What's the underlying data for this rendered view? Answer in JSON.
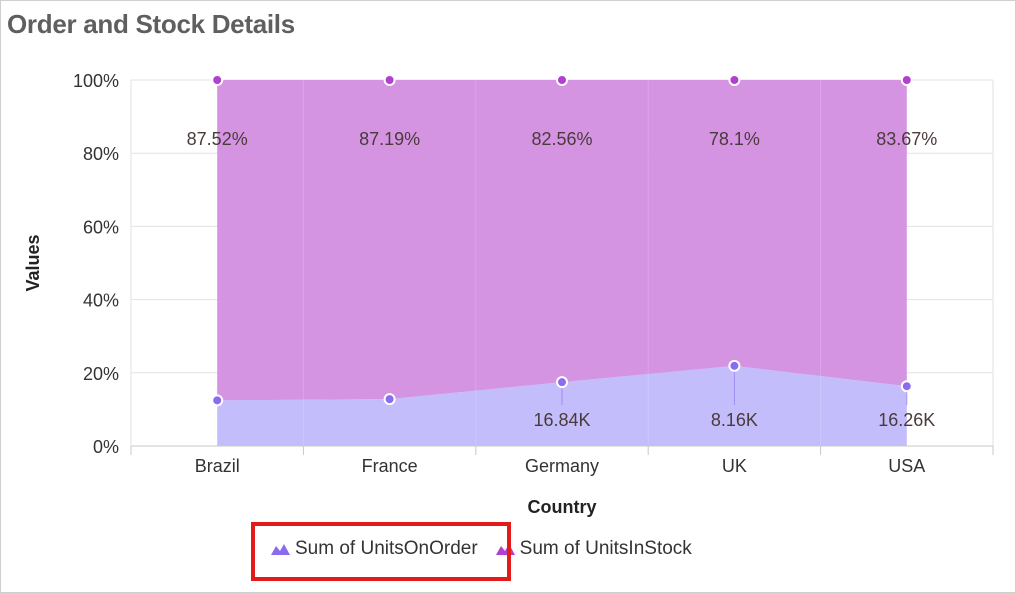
{
  "page": {
    "title": "Order and Stock Details"
  },
  "colors": {
    "on_order_fill": "#c0b9fb",
    "on_order_marker": "#8a6cf0",
    "in_stock_fill": "#d28ee0",
    "in_stock_marker": "#b23fcf",
    "highlight_border": "#e31b1b",
    "grid": "#e2e2e2"
  },
  "chart_data": {
    "type": "area",
    "stacking": "100%",
    "title": "Order and Stock Details",
    "xlabel": "Country",
    "ylabel": "Values",
    "ylim": [
      0,
      100
    ],
    "yticks": [
      "0%",
      "20%",
      "40%",
      "60%",
      "80%",
      "100%"
    ],
    "categories": [
      "Brazil",
      "France",
      "Germany",
      "UK",
      "USA"
    ],
    "series": [
      {
        "name": "Sum of UnitsOnOrder",
        "percent": [
          12.48,
          12.81,
          17.44,
          21.9,
          16.33
        ],
        "data_labels": [
          "",
          "",
          "16.84K",
          "8.16K",
          "16.26K"
        ]
      },
      {
        "name": "Sum of UnitsInStock",
        "percent": [
          87.52,
          87.19,
          82.56,
          78.1,
          83.67
        ],
        "data_labels": [
          "87.52%",
          "87.19%",
          "82.56%",
          "78.1%",
          "83.67%"
        ]
      }
    ],
    "grid": true,
    "legend_position": "bottom",
    "legend_highlight": "Sum of UnitsOnOrder"
  }
}
